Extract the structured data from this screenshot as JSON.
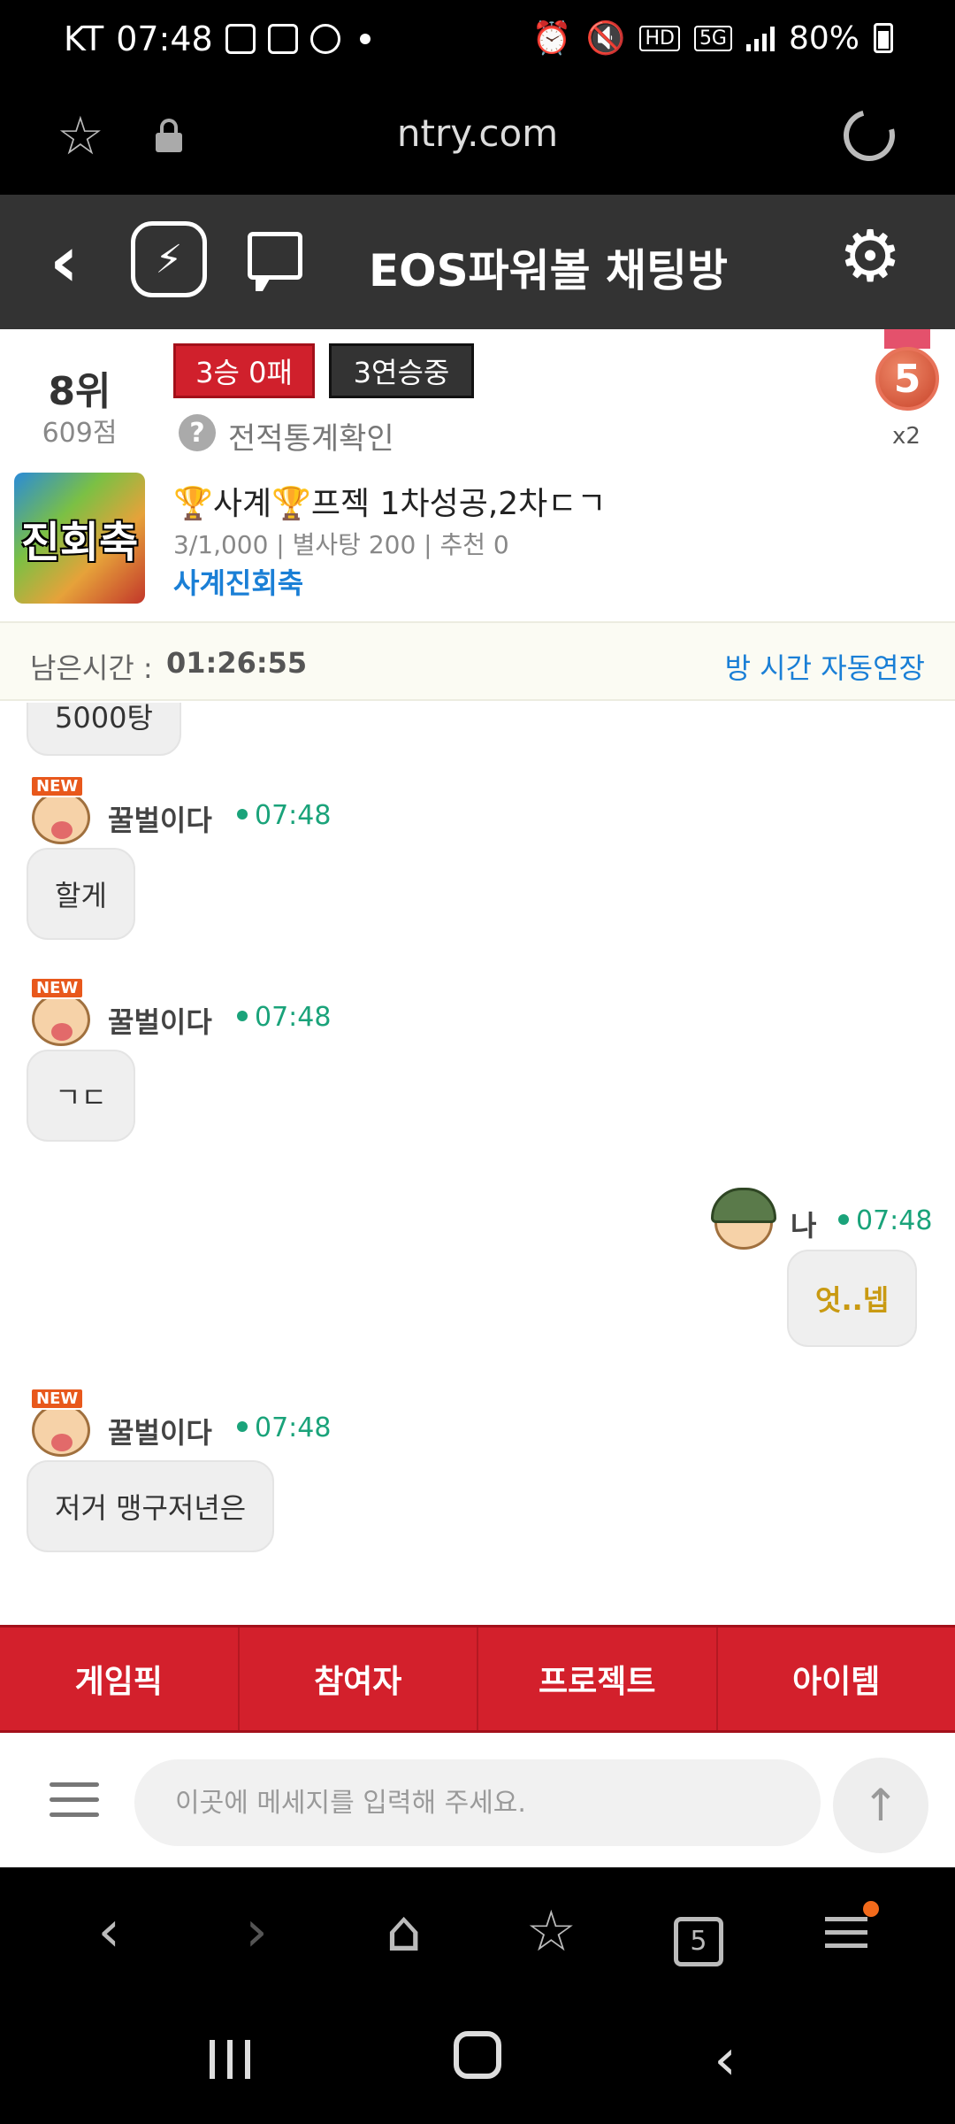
{
  "status_bar": {
    "carrier": "KT",
    "time": "07:48",
    "battery": "80%",
    "network": "5G",
    "hd": "HD"
  },
  "browser": {
    "url": "ntry.com"
  },
  "header": {
    "back_icon": "‹",
    "logo_icon": "run-icon",
    "title": "EOS파워볼 채팅방",
    "gear_icon": "⚙"
  },
  "room": {
    "rank": "8위",
    "points": "609점",
    "record_badge": "3승 0패",
    "streak_badge": "3연승중",
    "stats_link": "전적통계확인",
    "medal_level": "5",
    "medal_multiplier": "x2",
    "thumbnail_text": "진회축",
    "name": "🏆사계🏆프젝 1차성공,2차ㄷㄱ",
    "meta": "3/1,000 | 별사탕 200 | 추천 0",
    "owner": "사계진회축"
  },
  "timer": {
    "label": "남은시간 :",
    "value": "01:26:55",
    "extend_label": "방 시간 자동연장"
  },
  "messages": [
    {
      "text": "5000탕"
    },
    {
      "user": "꿀벌이다",
      "time": "07:48",
      "text": "할게"
    },
    {
      "user": "꿀벌이다",
      "time": "07:48",
      "text": "ㄱㄷ"
    },
    {
      "user": "나",
      "time": "07:48",
      "text": "엇..넵",
      "mine": true
    },
    {
      "user": "꿀벌이다",
      "time": "07:48",
      "text": "저거 맹구저년은"
    }
  ],
  "tabs": [
    "게임픽",
    "참여자",
    "프로젝트",
    "아이템"
  ],
  "input": {
    "placeholder": "이곳에 메세지를 입력해 주세요.",
    "send_icon": "↑"
  },
  "browser_nav": {
    "back_icon": "‹",
    "forward_icon": "›",
    "home_icon": "⌂",
    "bookmarks_icon": "☆",
    "tab_count": "5"
  },
  "system_nav": {
    "back_icon": "‹"
  },
  "colors": {
    "accent_red": "#d3202c",
    "header_dark": "#333333",
    "link_blue": "#1a7fd6",
    "online_green": "#1aa37a"
  }
}
